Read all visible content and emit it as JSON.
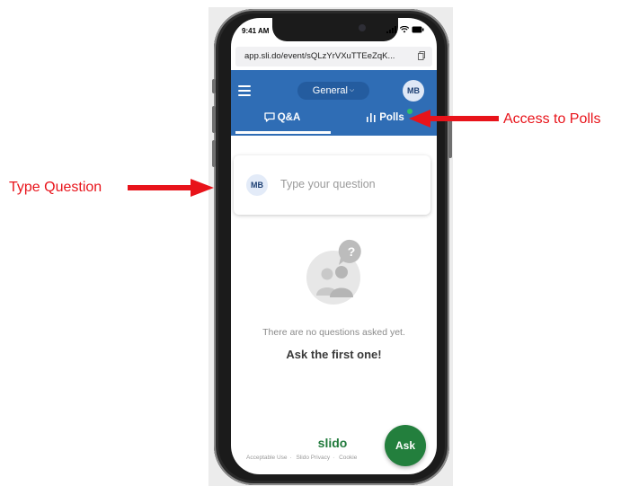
{
  "status_bar": {
    "time": "9:41 AM",
    "icons": [
      "cellular-icon",
      "wifi-icon",
      "battery-icon"
    ]
  },
  "browser": {
    "url": "app.sli.do/event/sQLzYrVXuTTEeZqK..."
  },
  "header": {
    "room_selector": "General",
    "avatar_initials": "MB",
    "tabs": [
      {
        "label": "Q&A",
        "icon": "speech-bubble-icon",
        "active": true
      },
      {
        "label": "Polls",
        "icon": "bar-chart-icon",
        "active": false,
        "has_notification": true
      }
    ]
  },
  "question_card": {
    "avatar_initials": "MB",
    "placeholder": "Type your question"
  },
  "empty_state": {
    "illustration": "people-question-icon",
    "message": "There are no questions asked yet.",
    "call_to_action": "Ask the first one!"
  },
  "footer": {
    "brand": "slido",
    "links": [
      "Acceptable Use",
      "Slido Privacy",
      "Cookie"
    ]
  },
  "ask_button": {
    "label": "Ask"
  },
  "annotations": {
    "polls": "Access to Polls",
    "type_question": "Type Question"
  },
  "colors": {
    "header_blue": "#2f6db5",
    "brand_green": "#237f3d",
    "annotation_red": "#e8131a"
  }
}
